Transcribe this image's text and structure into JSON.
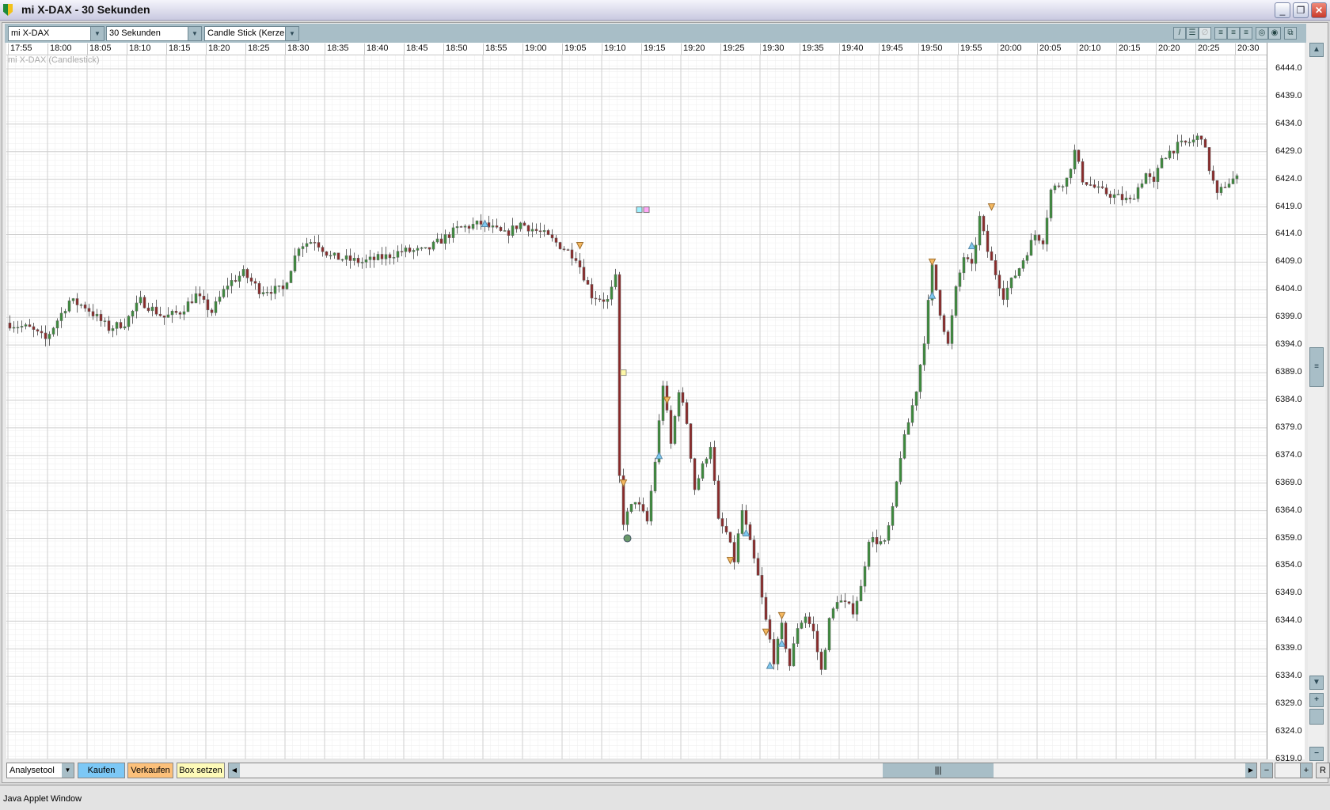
{
  "window": {
    "title": "mi X-DAX - 30 Sekunden",
    "minimize": "_",
    "restore": "❐",
    "close": "✕"
  },
  "toolbar": {
    "instrument": "mi X-DAX",
    "interval": "30 Sekunden",
    "chart_type": "Candle Stick (Kerzen"
  },
  "series_label": "mi X-DAX (Candlestick)",
  "bottom": {
    "tool": "Analysetool",
    "buy": "Kaufen",
    "sell": "Verkaufen",
    "box": "Box setzen",
    "reset": "R"
  },
  "status": "Java Applet Window",
  "colors": {
    "up": "#3c8c3c",
    "down": "#8c2a2a",
    "buy": "#7cc8f0",
    "sell": "#f4b860"
  },
  "chart_data": {
    "type": "candlestick",
    "interval_seconds": 30,
    "x_tick_labels": [
      "17:55",
      "18:00",
      "18:05",
      "18:10",
      "18:15",
      "18:20",
      "18:25",
      "18:30",
      "18:35",
      "18:40",
      "18:45",
      "18:50",
      "18:55",
      "19:00",
      "19:05",
      "19:10",
      "19:15",
      "19:20",
      "19:25",
      "19:30",
      "19:35",
      "19:40",
      "19:45",
      "19:50",
      "19:55",
      "20:00",
      "20:05",
      "20:10",
      "20:15",
      "20:20",
      "20:25",
      "20:30"
    ],
    "y_tick_labels": [
      "6444.0",
      "6439.0",
      "6434.0",
      "6429.0",
      "6424.0",
      "6419.0",
      "6414.0",
      "6409.0",
      "6404.0",
      "6399.0",
      "6394.0",
      "6389.0",
      "6384.0",
      "6379.0",
      "6374.0",
      "6369.0",
      "6364.0",
      "6359.0",
      "6354.0",
      "6349.0",
      "6344.0",
      "6339.0",
      "6334.0",
      "6329.0",
      "6324.0",
      "6319.0"
    ],
    "ylim": [
      6318,
      6446
    ],
    "price_path": [
      [
        "17:55",
        6398
      ],
      [
        "17:58",
        6397
      ],
      [
        "18:00",
        6395
      ],
      [
        "18:03",
        6402
      ],
      [
        "18:05",
        6401
      ],
      [
        "18:08",
        6397
      ],
      [
        "18:10",
        6398
      ],
      [
        "18:12",
        6402
      ],
      [
        "18:15",
        6399
      ],
      [
        "18:17",
        6400
      ],
      [
        "18:19",
        6403
      ],
      [
        "18:21",
        6400
      ],
      [
        "18:23",
        6405
      ],
      [
        "18:25",
        6407
      ],
      [
        "18:27",
        6404
      ],
      [
        "18:30",
        6404
      ],
      [
        "18:32",
        6412
      ],
      [
        "18:34",
        6413
      ],
      [
        "18:36",
        6410
      ],
      [
        "18:40",
        6409
      ],
      [
        "18:43",
        6410
      ],
      [
        "18:45",
        6411
      ],
      [
        "18:48",
        6411
      ],
      [
        "18:52",
        6415
      ],
      [
        "18:55",
        6416
      ],
      [
        "18:58",
        6414
      ],
      [
        "19:00",
        6416
      ],
      [
        "19:03",
        6414
      ],
      [
        "19:05",
        6412
      ],
      [
        "19:07",
        6410
      ],
      [
        "19:09",
        6403
      ],
      [
        "19:11",
        6402
      ],
      [
        "19:12",
        6406
      ],
      [
        "19:12.5",
        6370
      ],
      [
        "19:13",
        6362
      ],
      [
        "19:14.5",
        6366
      ],
      [
        "19:16",
        6362
      ],
      [
        "19:17",
        6373
      ],
      [
        "19:18",
        6387
      ],
      [
        "19:19",
        6376
      ],
      [
        "19:20",
        6386
      ],
      [
        "19:21",
        6380
      ],
      [
        "19:22",
        6368
      ],
      [
        "19:24",
        6376
      ],
      [
        "19:25",
        6362
      ],
      [
        "19:26",
        6360
      ],
      [
        "19:27",
        6355
      ],
      [
        "19:28",
        6364
      ],
      [
        "19:29",
        6358
      ],
      [
        "19:30",
        6352
      ],
      [
        "19:31",
        6344
      ],
      [
        "19:32",
        6337
      ],
      [
        "19:33",
        6343
      ],
      [
        "19:34",
        6336
      ],
      [
        "19:35",
        6343
      ],
      [
        "19:36",
        6345
      ],
      [
        "19:37",
        6342
      ],
      [
        "19:38",
        6335
      ],
      [
        "19:39",
        6344
      ],
      [
        "19:40",
        6348
      ],
      [
        "19:42",
        6346
      ],
      [
        "19:43",
        6350
      ],
      [
        "19:44",
        6359
      ],
      [
        "19:46",
        6358
      ],
      [
        "19:47",
        6364
      ],
      [
        "19:48",
        6374
      ],
      [
        "19:49",
        6380
      ],
      [
        "19:50",
        6386
      ],
      [
        "19:51",
        6395
      ],
      [
        "19:52",
        6408
      ],
      [
        "19:53",
        6400
      ],
      [
        "19:54",
        6394
      ],
      [
        "19:55",
        6404
      ],
      [
        "19:56",
        6410
      ],
      [
        "19:57",
        6408
      ],
      [
        "19:58",
        6417
      ],
      [
        "19:59",
        6411
      ],
      [
        "20:00",
        6407
      ],
      [
        "20:01",
        6403
      ],
      [
        "20:03",
        6408
      ],
      [
        "20:05",
        6414
      ],
      [
        "20:06",
        6413
      ],
      [
        "20:07",
        6422
      ],
      [
        "20:09",
        6424
      ],
      [
        "20:10",
        6429
      ],
      [
        "20:11",
        6424
      ],
      [
        "20:13",
        6422
      ],
      [
        "20:15",
        6421
      ],
      [
        "20:17",
        6420
      ],
      [
        "20:19",
        6425
      ],
      [
        "20:20",
        6423
      ],
      [
        "20:21",
        6428
      ],
      [
        "20:23",
        6430
      ],
      [
        "20:25",
        6431
      ],
      [
        "20:26",
        6432
      ],
      [
        "20:27",
        6426
      ],
      [
        "20:28",
        6421
      ],
      [
        "20:29",
        6423
      ],
      [
        "20:30",
        6424
      ]
    ],
    "markers": [
      {
        "type": "buy",
        "time": "18:55",
        "price": 6416
      },
      {
        "type": "sell",
        "time": "19:07",
        "price": 6412
      },
      {
        "type": "box",
        "time": "19:12.5",
        "price": 6389
      },
      {
        "type": "sell",
        "time": "19:12.5",
        "price": 6369
      },
      {
        "type": "circle",
        "time": "19:13",
        "price": 6359
      },
      {
        "type": "buy",
        "time": "19:17",
        "price": 6374
      },
      {
        "type": "sell",
        "time": "19:18",
        "price": 6384
      },
      {
        "type": "sell",
        "time": "19:26",
        "price": 6355
      },
      {
        "type": "buy",
        "time": "19:28",
        "price": 6360
      },
      {
        "type": "sell",
        "time": "19:30.5",
        "price": 6342
      },
      {
        "type": "buy",
        "time": "19:31",
        "price": 6336
      },
      {
        "type": "sell",
        "time": "19:32.5",
        "price": 6345
      },
      {
        "type": "buy",
        "time": "19:32.5",
        "price": 6340
      },
      {
        "type": "buy",
        "time": "19:51.5",
        "price": 6403
      },
      {
        "type": "sell",
        "time": "19:51.5",
        "price": 6409
      },
      {
        "type": "buy",
        "time": "19:56.5",
        "price": 6412
      },
      {
        "type": "sell",
        "time": "19:59",
        "price": 6419
      }
    ]
  }
}
